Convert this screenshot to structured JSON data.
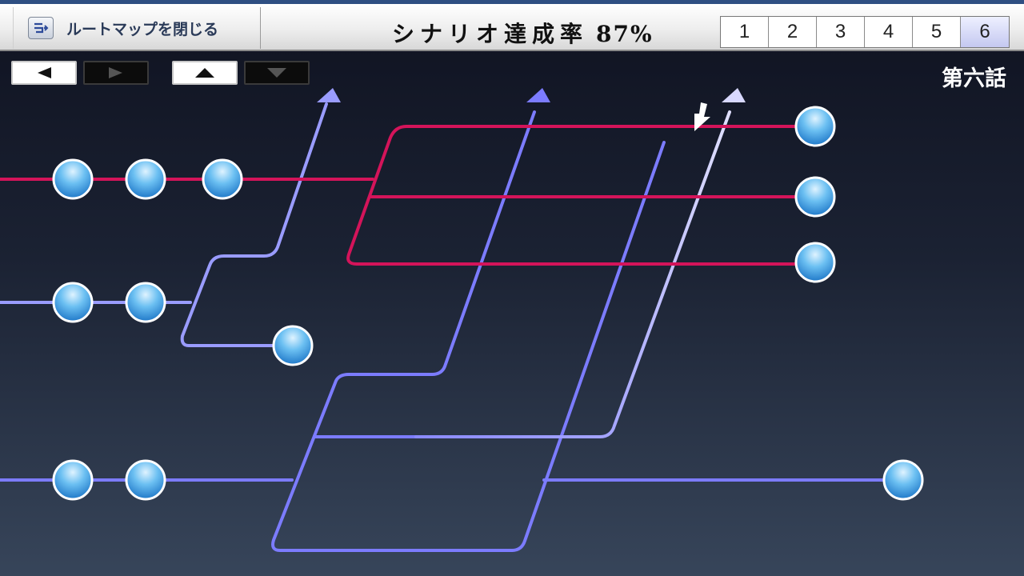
{
  "header": {
    "close_label": "ルートマップを閉じる",
    "rate_label": "シナリオ達成率",
    "rate_value": "87%",
    "chapters": [
      "1",
      "2",
      "3",
      "4",
      "5",
      "6"
    ],
    "active_chapter": "6"
  },
  "episode_title": "第六話",
  "colors": {
    "red_route": "#d4145a",
    "violet_route": "#7a7aff",
    "pale_route": "#c8c8ff",
    "node": "#5fb4ee"
  },
  "icons": [
    "close-map-icon",
    "left-arrow-icon",
    "right-arrow-icon",
    "up-arrow-icon",
    "down-arrow-icon",
    "current-position-icon"
  ]
}
